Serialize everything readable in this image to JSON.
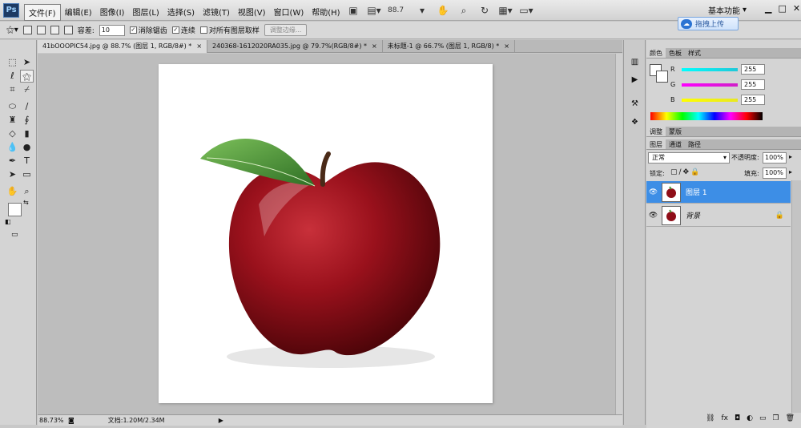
{
  "app": {
    "logo": "Ps"
  },
  "menu": [
    "文件(F)",
    "编辑(E)",
    "图像(I)",
    "图层(L)",
    "选择(S)",
    "滤镜(T)",
    "视图(V)",
    "窗口(W)",
    "帮助(H)"
  ],
  "menubar_tools": {
    "zoom": "88.7"
  },
  "workspace": {
    "label": "基本功能"
  },
  "upload": {
    "label": "拖拽上传"
  },
  "options": {
    "tolerance_label": "容差:",
    "tolerance_value": "10",
    "antialias": "消除锯齿",
    "contiguous": "连续",
    "sample_all": "对所有图层取样",
    "refine": "调整边缘..."
  },
  "tabs": [
    {
      "label": "41bOOOPIC54.jpg @ 88.7% (图层 1, RGB/8#) *",
      "close": "×"
    },
    {
      "label": "240368-1612020RA035.jpg @ 79.7%(RGB/8#) *",
      "close": "×"
    },
    {
      "label": "未标题-1 @ 66.7% (图层 1, RGB/8) *",
      "close": "×"
    }
  ],
  "status": {
    "zoom": "88.73%",
    "doc": "文档:1.20M/2.34M"
  },
  "color_panel": {
    "tabs": [
      "颜色",
      "色板",
      "样式"
    ],
    "channels": [
      {
        "name": "R",
        "value": "255",
        "color": "#20c8d8"
      },
      {
        "name": "G",
        "value": "255",
        "color": "#d020c8"
      },
      {
        "name": "B",
        "value": "255",
        "color": "#e8e820"
      }
    ]
  },
  "adjust_tabs": [
    "调整",
    "蒙版"
  ],
  "layers_panel": {
    "tabs": [
      "图层",
      "通道",
      "路径"
    ],
    "blend_mode": "正常",
    "opacity_label": "不透明度:",
    "opacity": "100%",
    "lock_label": "锁定:",
    "fill_label": "填充:",
    "fill": "100%",
    "layers": [
      {
        "name": "图层 1",
        "selected": true
      },
      {
        "name": "背景",
        "selected": false,
        "locked": true
      }
    ]
  },
  "colors": {
    "selection": "#3d8ee6",
    "apple": "#8f0e18",
    "leaf": "#4f9a3a"
  }
}
